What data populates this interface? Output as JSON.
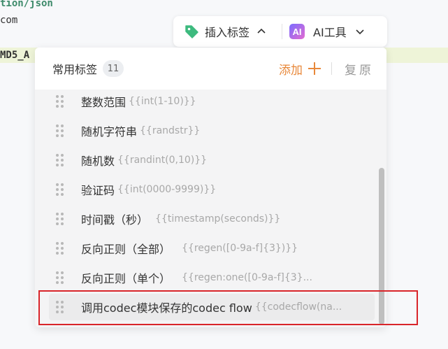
{
  "editor": {
    "line1": "tion/json",
    "line2": "com",
    "line3": "MD5_A"
  },
  "toolbar": {
    "insert_label": "插入标签",
    "ai_icon_text": "AI",
    "ai_label": "AI工具"
  },
  "panel": {
    "title": "常用标签",
    "count": "11",
    "add_label": "添加",
    "restore_label": "复原",
    "items": [
      {
        "name": "整数范围",
        "code": "{{int(1-10)}}"
      },
      {
        "name": "随机字符串",
        "code": "{{randstr}}"
      },
      {
        "name": "随机数",
        "code": "{{randint(0,10)}}"
      },
      {
        "name": "验证码",
        "code": "{{int(0000-9999)}}"
      },
      {
        "name": "时间戳（秒）",
        "code": "{{timestamp(seconds)}}"
      },
      {
        "name": "反向正则（全部）",
        "code": "{{regen([0-9a-f]{3})}}"
      },
      {
        "name": "反向正则（单个）",
        "code": "{{regen:one([0-9a-f]{3}..."
      },
      {
        "name": "调用codec模块保存的codec flow",
        "code": "{{codecflow(na..."
      }
    ]
  },
  "colors": {
    "accent": "#e8883a",
    "highlight_border": "#d9252a",
    "tag_icon": "#3dba7e"
  }
}
